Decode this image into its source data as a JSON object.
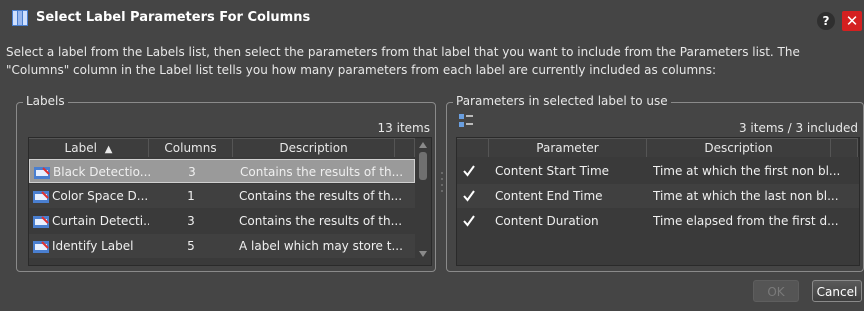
{
  "dialog": {
    "title": "Select Label Parameters For Columns",
    "help_label": "?",
    "close_label": "✕",
    "instructions": "Select a label from the Labels list, then select the parameters from that label that you want to include from the Parameters list. The \"Columns\" column in the Label list tells you how many parameters from each label are currently included as columns:"
  },
  "labels_panel": {
    "legend": "Labels",
    "count": "13 items",
    "columns": {
      "label": "Label",
      "sort_indicator": "▲",
      "columns": "Columns",
      "description": "Description"
    },
    "rows": [
      {
        "label": "Black Detectio...",
        "columns": "3",
        "description": "Contains the results of th...",
        "selected": true
      },
      {
        "label": "Color Space D...",
        "columns": "1",
        "description": "Contains the results of th..."
      },
      {
        "label": "Curtain Detecti...",
        "columns": "3",
        "description": "Contains the results of th..."
      },
      {
        "label": "Identify Label",
        "columns": "5",
        "description": "A label which may store t..."
      }
    ]
  },
  "params_panel": {
    "legend": "Parameters in selected label to use",
    "count": "3 items / 3 included",
    "columns": {
      "parameter": "Parameter",
      "description": "Description"
    },
    "rows": [
      {
        "checked": true,
        "parameter": "Content Start Time",
        "description": "Time at which the first non bl..."
      },
      {
        "checked": true,
        "parameter": "Content End Time",
        "description": "Time at which the last non bl..."
      },
      {
        "checked": true,
        "parameter": "Content Duration",
        "description": "Time elapsed from the first d..."
      }
    ]
  },
  "buttons": {
    "ok": "OK",
    "cancel": "Cancel"
  },
  "colors": {
    "background": "#454545",
    "close": "#d42020",
    "selected_row": "#9a9a9a"
  },
  "icons": {
    "title": "dialog-columns-icon",
    "label_row": "label-icon",
    "param_toolbar": "column-select-icon",
    "check": "checkmark-icon"
  }
}
